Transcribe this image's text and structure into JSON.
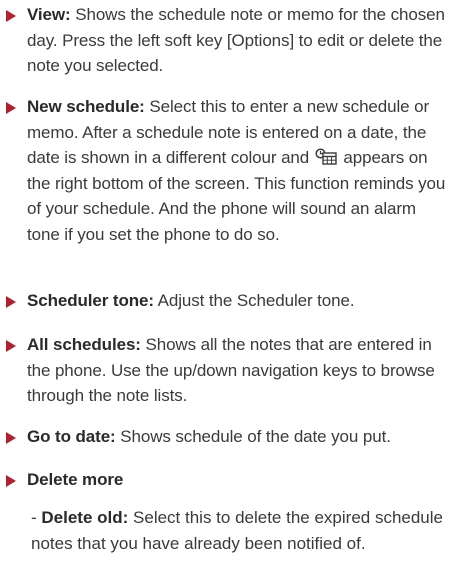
{
  "items": [
    {
      "term": "View:",
      "text": " Shows the schedule note or memo for the chosen day. Press the left soft key [Options] to edit or delete the note you selected."
    },
    {
      "term": "New schedule:",
      "text_a": " Select this to enter a new schedule or memo. After a schedule note is entered on a date, the date is shown in a different colour and ",
      "icon": "schedule-alarm-icon",
      "text_b": " appears on the right bottom of the screen. This function reminds you of your schedule. And the phone will sound an alarm tone if you set the phone to do so."
    },
    {
      "term": "Scheduler tone:",
      "text": " Adjust the Scheduler tone."
    },
    {
      "term": "All schedules:",
      "text": " Shows all the notes that are entered in the phone. Use the up/down navigation keys to browse through the note lists."
    },
    {
      "term": "Go to date:",
      "text": " Shows schedule of the date you put."
    },
    {
      "term": "Delete more",
      "text": ""
    }
  ],
  "subitems": [
    {
      "dash": "- ",
      "term": "Delete old:",
      "text": " Select this to delete the expired schedule notes that you have already been notified of."
    }
  ],
  "colors": {
    "bullet": "#ad2230",
    "text": "#3a3a3a"
  }
}
